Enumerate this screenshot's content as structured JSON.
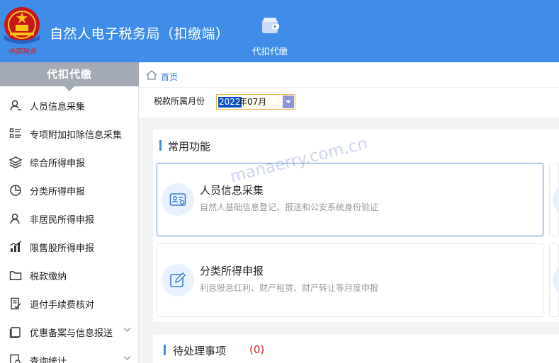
{
  "header": {
    "app_title": "自然人电子税务局（扣缴端）",
    "emblem_caption": "中国税务",
    "tabs": [
      {
        "label": "代扣代缴",
        "icon": "wallet-icon"
      }
    ]
  },
  "sidebar": {
    "title": "代扣代缴",
    "items": [
      {
        "label": "人员信息采集",
        "icon": "person-icon"
      },
      {
        "label": "专项附加扣除信息采集",
        "icon": "list-icon"
      },
      {
        "label": "综合所得申报",
        "icon": "layers-icon"
      },
      {
        "label": "分类所得申报",
        "icon": "pie-chart-icon"
      },
      {
        "label": "非居民所得申报",
        "icon": "user-icon"
      },
      {
        "label": "限售股所得申报",
        "icon": "bar-chart-icon"
      },
      {
        "label": "税款缴纳",
        "icon": "folder-icon"
      },
      {
        "label": "退付手续费核对",
        "icon": "document-check-icon"
      },
      {
        "label": "优惠备案与信息报送",
        "icon": "box-icon",
        "has_submenu": true
      },
      {
        "label": "查询统计",
        "icon": "search-doc-icon",
        "has_submenu": true
      }
    ]
  },
  "breadcrumb": {
    "home": "首页"
  },
  "filter": {
    "label": "税款所属月份",
    "value_year": "2022",
    "value_rest": "年07月"
  },
  "common_functions": {
    "title": "常用功能",
    "cards": [
      {
        "title": "人员信息采集",
        "desc": "自然人基础信息登记、报送和公安系统身份验证",
        "icon": "id-card-icon",
        "active": true
      },
      {
        "title": "分类所得申报",
        "desc": "利息股息红利、财产租赁、财产转让等月度申报",
        "icon": "edit-icon",
        "active": false
      }
    ]
  },
  "pending": {
    "title": "待处理事项",
    "count": "(0)"
  },
  "watermark": "manaerry.com.cn",
  "colors": {
    "header_blue": "#3f8de8",
    "sidebar_head": "#a3aab3",
    "accent": "#3f8de8",
    "count_red": "#e02020"
  }
}
